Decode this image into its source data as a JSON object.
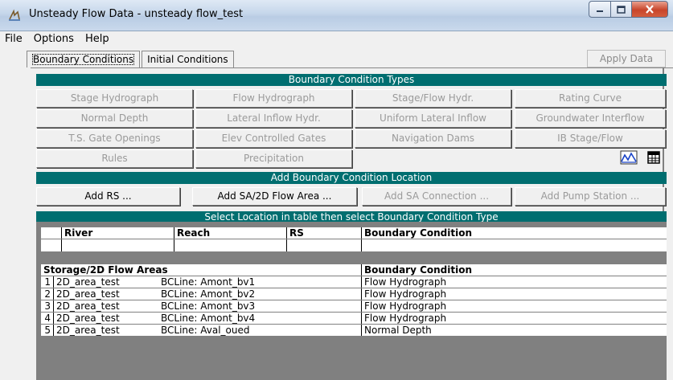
{
  "window": {
    "title": "Unsteady Flow Data - unsteady flow_test"
  },
  "menu": [
    "File",
    "Options",
    "Help"
  ],
  "tabs": [
    "Boundary Conditions",
    "Initial Conditions"
  ],
  "apply_label": "Apply Data",
  "bc_types": {
    "title": "Boundary Condition Types",
    "buttons": [
      "Stage Hydrograph",
      "Flow Hydrograph",
      "Stage/Flow Hydr.",
      "Rating Curve",
      "Normal Depth",
      "Lateral Inflow Hydr.",
      "Uniform Lateral Inflow",
      "Groundwater Interflow",
      "T.S. Gate Openings",
      "Elev Controlled Gates",
      "Navigation Dams",
      "IB Stage/Flow",
      "Rules",
      "Precipitation"
    ]
  },
  "add_location": {
    "title": "Add Boundary Condition Location",
    "buttons": [
      "Add RS ...",
      "Add SA/2D Flow Area ...",
      "Add SA Connection ...",
      "Add Pump Station ..."
    ]
  },
  "table": {
    "title": "Select Location in table then select Boundary Condition Type",
    "river_headers": [
      "River",
      "Reach",
      "RS",
      "Boundary Condition"
    ],
    "storage_headers": [
      "Storage/2D Flow Areas",
      "Boundary Condition"
    ],
    "rows": [
      {
        "n": "1",
        "area": "2D_area_test",
        "line": "BCLine: Amont_bv1",
        "bc": "Flow Hydrograph"
      },
      {
        "n": "2",
        "area": "2D_area_test",
        "line": "BCLine: Amont_bv2",
        "bc": "Flow Hydrograph"
      },
      {
        "n": "3",
        "area": "2D_area_test",
        "line": "BCLine: Amont_bv3",
        "bc": "Flow Hydrograph"
      },
      {
        "n": "4",
        "area": "2D_area_test",
        "line": "BCLine: Amont_bv4",
        "bc": "Flow Hydrograph"
      },
      {
        "n": "5",
        "area": "2D_area_test",
        "line": "BCLine: Aval_oued",
        "bc": "Normal Depth"
      }
    ]
  },
  "icons": {
    "plot": "hydrograph-plot-icon",
    "table": "table-icon"
  }
}
